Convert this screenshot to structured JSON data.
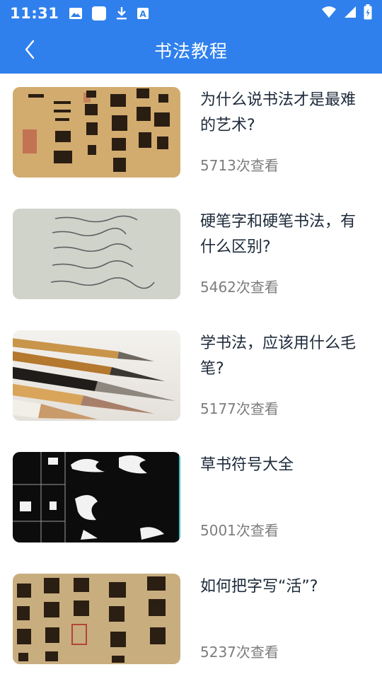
{
  "status_bar": {
    "time": "11:31",
    "left_icons": [
      "image-icon",
      "square-icon",
      "download-icon",
      "text-icon"
    ],
    "right_icons": [
      "wifi-icon",
      "signal-icon",
      "battery-icon"
    ]
  },
  "app_bar": {
    "title": "书法教程",
    "back_icon": "chevron-left-icon"
  },
  "colors": {
    "primary": "#2f80ed",
    "title_text": "#1d2a3a",
    "meta_text": "#7d7d7d"
  },
  "articles": [
    {
      "title": "为什么说书法才是最难的艺术?",
      "views": "5713次查看",
      "thumb": "calligraphy-scroll-image"
    },
    {
      "title": "硬笔字和硬笔书法，有什么区别?",
      "views": "5462次查看",
      "thumb": "handwriting-paper-image"
    },
    {
      "title": "学书法，应该用什么毛笔?",
      "views": "5177次查看",
      "thumb": "brushes-image"
    },
    {
      "title": "草书符号大全",
      "views": "5001次查看",
      "thumb": "cursive-chart-image"
    },
    {
      "title": "如何把字写“活”?",
      "views": "5237次查看",
      "thumb": "thousand-character-scroll-image"
    }
  ]
}
